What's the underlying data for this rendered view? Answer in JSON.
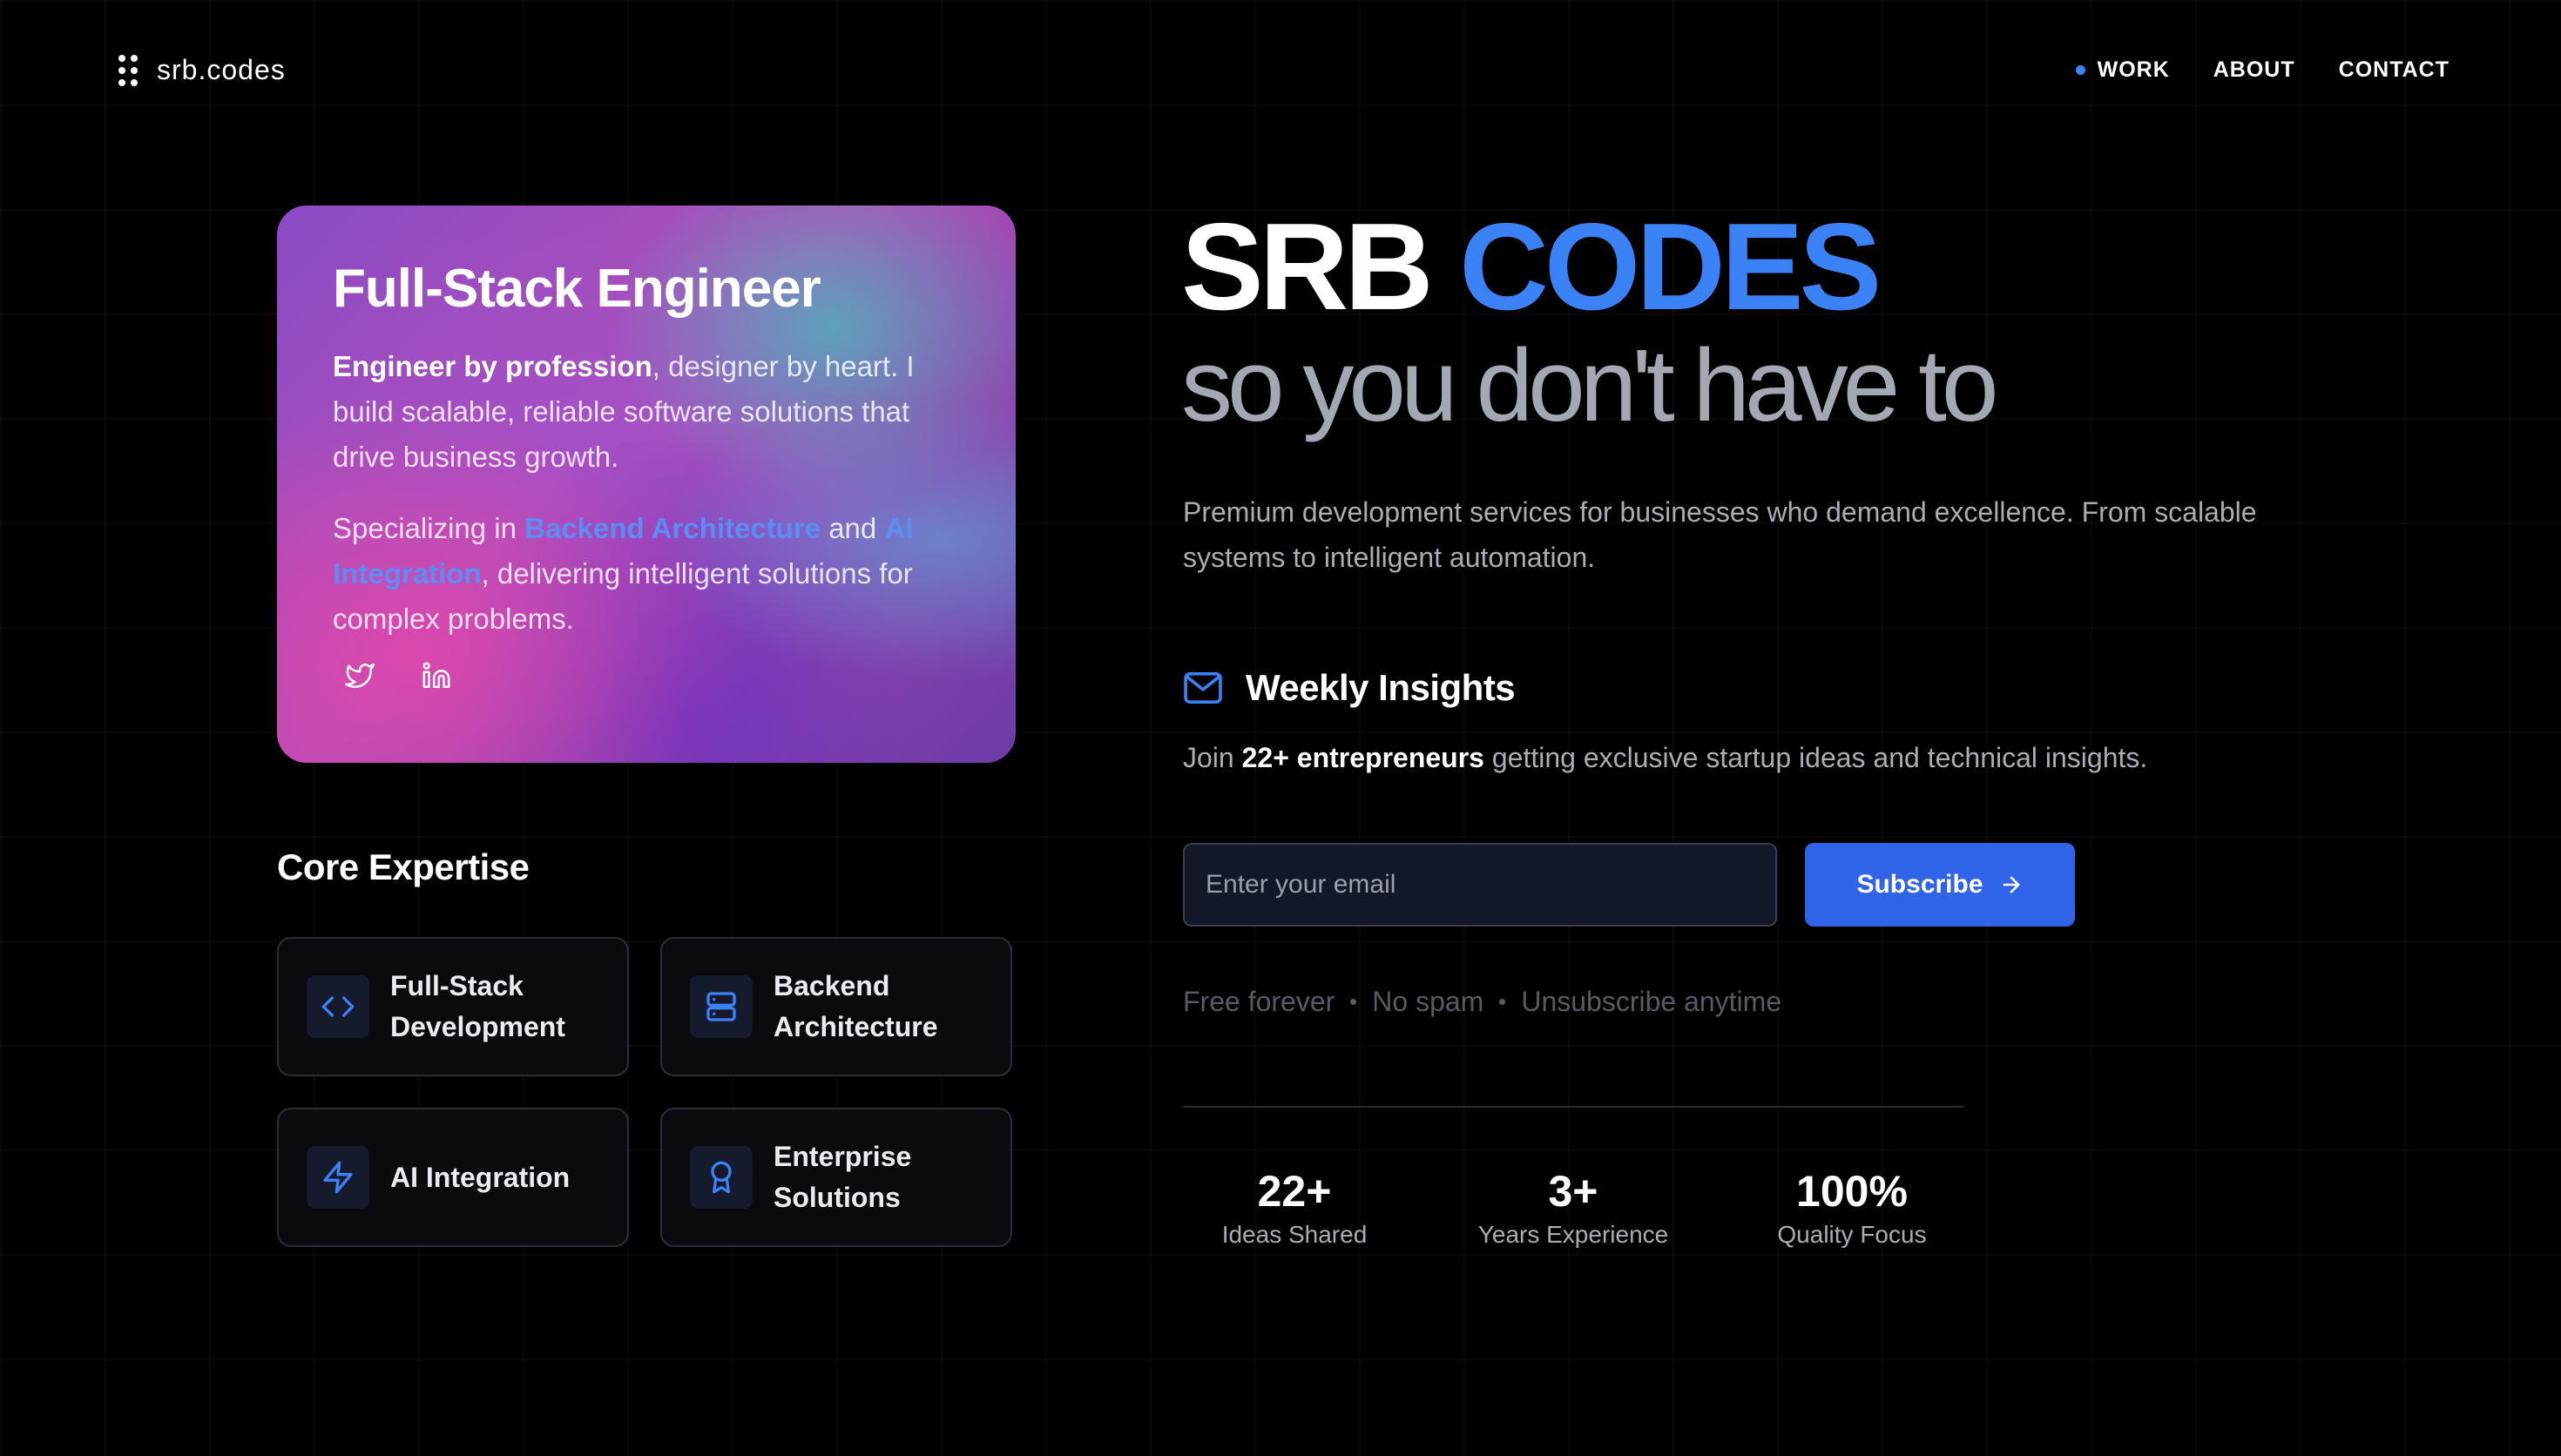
{
  "header": {
    "logo_text": "srb.codes",
    "nav": [
      {
        "label": "WORK",
        "active": true
      },
      {
        "label": "ABOUT",
        "active": false
      },
      {
        "label": "CONTACT",
        "active": false
      }
    ]
  },
  "profile_card": {
    "title": "Full-Stack Engineer",
    "p1_bold": "Engineer by profession",
    "p1_rest": ", designer by heart. I build scalable, reliable software solutions that drive business growth.",
    "p2_start": "Specializing in ",
    "p2_hl1": "Backend Architecture",
    "p2_mid": " and ",
    "p2_hl2": "AI Integration",
    "p2_end": ", delivering intelligent solutions for complex problems.",
    "socials": [
      "twitter-icon",
      "linkedin-icon"
    ]
  },
  "core_expertise": {
    "title": "Core Expertise",
    "items": [
      {
        "label": "Full-Stack Development",
        "icon": "code-icon"
      },
      {
        "label": "Backend Architecture",
        "icon": "server-icon"
      },
      {
        "label": "AI Integration",
        "icon": "lightning-icon"
      },
      {
        "label": "Enterprise Solutions",
        "icon": "award-icon"
      }
    ]
  },
  "hero": {
    "title_white": "SRB",
    "title_blue": "CODES",
    "subtitle": "so you don't have to",
    "lead": "Premium development services for businesses who demand excellence. From scalable systems to intelligent automation."
  },
  "newsletter": {
    "icon": "mail-icon",
    "title": "Weekly Insights",
    "join_start": "Join ",
    "join_bold": "22+ entrepreneurs",
    "join_end": " getting exclusive startup ideas and technical insights.",
    "email_placeholder": "Enter your email",
    "email_value": "",
    "button_label": "Subscribe",
    "fine_print": [
      "Free forever",
      "No spam",
      "Unsubscribe anytime"
    ]
  },
  "stats": [
    {
      "value": "22+",
      "label": "Ideas Shared"
    },
    {
      "value": "3+",
      "label": "Years Experience"
    },
    {
      "value": "100%",
      "label": "Quality Focus"
    }
  ],
  "colors": {
    "accent": "#3b82f6",
    "button": "#2f64e8",
    "background": "#000000"
  }
}
